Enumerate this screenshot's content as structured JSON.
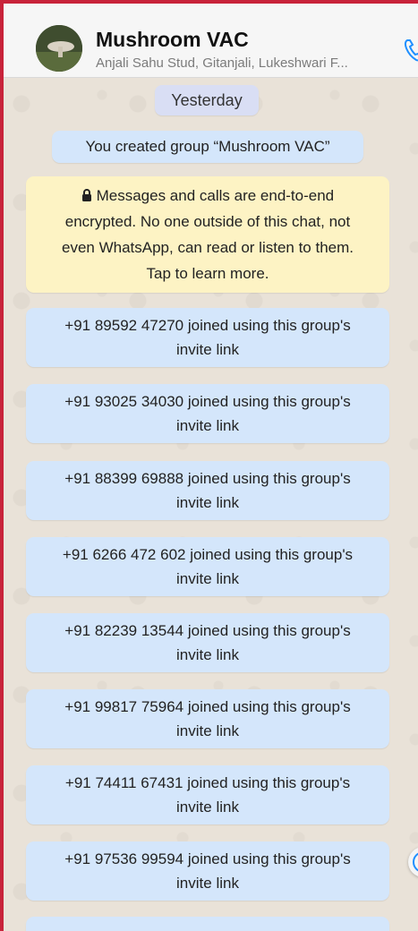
{
  "header": {
    "title": "Mushroom VAC",
    "subtitle": "Anjali Sahu Stud, Gitanjali, Lukeshwari F..."
  },
  "chat": {
    "date_chip": "Yesterday",
    "created_message": "You created group “Mushroom VAC”",
    "encryption_notice": {
      "line1": "Messages and calls are end-to-end",
      "line2": "encrypted. No one outside of this chat, not",
      "line3": "even WhatsApp, can read or listen to them.",
      "line4": "Tap to learn more."
    },
    "join_suffix": "invite link",
    "joins": [
      {
        "text": "+91 89592 47270 joined using this group's"
      },
      {
        "text": "+91 93025 34030 joined using this group's"
      },
      {
        "text": "+91 88399 69888 joined using this group's"
      },
      {
        "text": "+91 6266 472 602 joined using this group's"
      },
      {
        "text": "+91 82239 13544 joined using this group's"
      },
      {
        "text": "+91 99817 75964 joined using this group's"
      },
      {
        "text": "+91 74411 67431 joined using this group's"
      },
      {
        "text": "+91 97536 99594 joined using this group's"
      }
    ]
  },
  "colors": {
    "accent": "#1f8fff",
    "system_bubble": "#d4e6fb",
    "encryption_bubble": "#fdf3c4"
  },
  "icons": {
    "call": "phone-icon",
    "lock": "lock-icon",
    "scroll": "chevron-down-icon"
  }
}
